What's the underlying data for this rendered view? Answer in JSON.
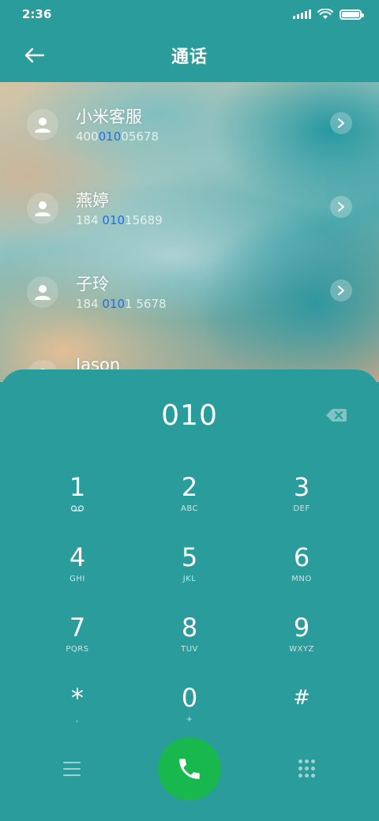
{
  "status_bar": {
    "time": "2:36"
  },
  "header": {
    "title": "通话"
  },
  "results": [
    {
      "name": "小米客服",
      "number_parts": [
        "400",
        "010",
        "05678"
      ]
    },
    {
      "name": "燕婷",
      "number_parts": [
        "184 ",
        "010",
        "15689"
      ]
    },
    {
      "name": "子玲",
      "number_parts": [
        "184 ",
        "010",
        "1 5678"
      ]
    },
    {
      "name": "Jason",
      "number_parts": [
        "",
        "",
        ""
      ]
    }
  ],
  "dialpad": {
    "digits": "010",
    "keys": [
      {
        "num": "1",
        "sub": "voicemail"
      },
      {
        "num": "2",
        "sub": "ABC"
      },
      {
        "num": "3",
        "sub": "DEF"
      },
      {
        "num": "4",
        "sub": "GHI"
      },
      {
        "num": "5",
        "sub": "JKL"
      },
      {
        "num": "6",
        "sub": "MNO"
      },
      {
        "num": "7",
        "sub": "PQRS"
      },
      {
        "num": "8",
        "sub": "TUV"
      },
      {
        "num": "9",
        "sub": "WXYZ"
      },
      {
        "num": "*",
        "sub": ","
      },
      {
        "num": "0",
        "sub": "+"
      },
      {
        "num": "#",
        "sub": ""
      }
    ]
  },
  "colors": {
    "panel": "#2a9c9c",
    "call_button": "#18b84e",
    "match_highlight": "#1e6fe0"
  }
}
